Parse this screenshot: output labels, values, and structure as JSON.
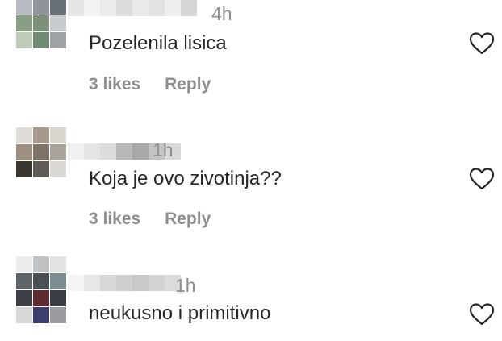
{
  "comments": [
    {
      "time": "4h",
      "text": "Pozelenila lisica",
      "likes": "3 likes",
      "reply": "Reply",
      "avatar_colors": [
        "#b8bcc2",
        "#8e949c",
        "#6a7078",
        "#8a9e86",
        "#7c9079",
        "#c8ccd0",
        "#bfcbb8",
        "#6f8b72",
        "#9ea2a6"
      ],
      "username_colors": [
        "#e6e6e6",
        "#f2f2f2",
        "#ebebeb",
        "#dcdcdc",
        "#e9e9e9",
        "#e2e2e2",
        "#eeeeee",
        "#d6d6d6"
      ],
      "icon": "heart-outline-icon"
    },
    {
      "time": "1h",
      "text": "Koja je ovo zivotinja??",
      "likes": "3 likes",
      "reply": "Reply",
      "avatar_colors": [
        "#e0ddd8",
        "#a79a8c",
        "#d9d5cf",
        "#9c8f80",
        "#7e7366",
        "#a8a29a",
        "#3b3530",
        "#5f5a55",
        "#dad8d5"
      ],
      "username_colors": [
        "#f0f0f0",
        "#e4e4e4",
        "#dddddd",
        "#b8b8b8",
        "#a8a8a8",
        "#c4c4c4",
        "#d8d8d8"
      ],
      "icon": "heart-outline-icon"
    },
    {
      "time": "1h",
      "text": "neukusno i primitivno",
      "likes": "",
      "reply": "",
      "avatar_colors": [
        "#ececec",
        "#bfc3c6",
        "#e2e2e2",
        "#5f6469",
        "#4a4e55",
        "#7a8d90",
        "#3c3f46",
        "#5e2a30",
        "#3a3d44",
        "#d8d8d8",
        "#3b3e6e",
        "#9a9ca0"
      ],
      "username_colors": [
        "#f4f4f4",
        "#e7e7e7",
        "#d7d7d7",
        "#cfcfcf",
        "#c9c9c9",
        "#d2d2d2",
        "#dbdbdb"
      ],
      "icon": "heart-outline-icon"
    }
  ]
}
